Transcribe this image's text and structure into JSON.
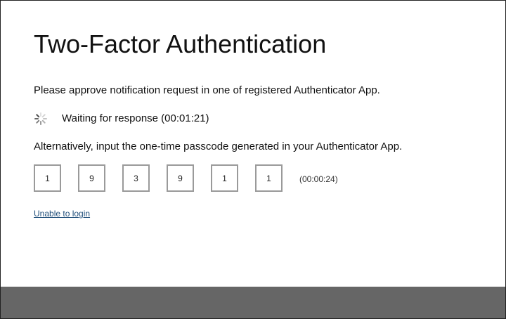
{
  "page": {
    "title": "Two-Factor Authentication",
    "push_instruction": "Please approve notification request in one of registered Authenticator App.",
    "waiting_text": "Waiting for response (00:01:21)",
    "otp_instruction": "Alternatively, input the one-time passcode generated in your Authenticator App.",
    "otp_digits": [
      "1",
      "9",
      "3",
      "9",
      "1",
      "1"
    ],
    "otp_timer": "(00:00:24)",
    "unable_link": "Unable to login"
  },
  "colors": {
    "footer_bar": "#666666",
    "link": "#1f4e7a",
    "box_border": "#9a9a9a"
  },
  "icons": {
    "spinner": "loading-spinner-icon"
  }
}
